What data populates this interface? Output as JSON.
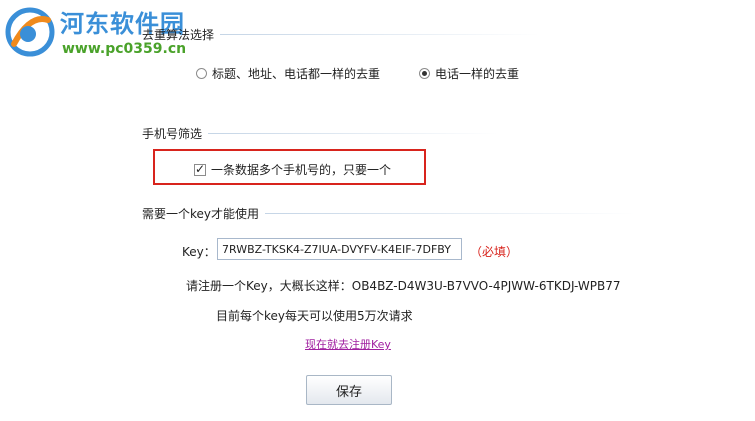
{
  "watermark": {
    "title": "河东软件园",
    "url": "www.pc0359.cn"
  },
  "dedupe": {
    "header": "去重算法选择",
    "options": [
      {
        "label": "标题、地址、电话都一样的去重",
        "selected": false
      },
      {
        "label": "电话一样的去重",
        "selected": true
      }
    ]
  },
  "phone_filter": {
    "header": "手机号筛选",
    "checkbox_label": "一条数据多个手机号的，只要一个",
    "checked": true
  },
  "key_section": {
    "header": "需要一个key才能使用",
    "key_label": "Key：",
    "key_value": "7RWBZ-TKSK4-Z7IUA-DVYFV-K4EIF-7DFBY",
    "required_note": "（必填）",
    "register_hint": "请注册一个Key，大概长这样：OB4BZ-D4W3U-B7VVO-4PJWW-6TKDJ-WPB77",
    "daily_limit": "目前每个key每天可以使用5万次请求",
    "register_link": "现在就去注册Key"
  },
  "actions": {
    "save_label": "保存"
  },
  "colors": {
    "accent_red": "#d8241d",
    "link_purple": "#a020a0",
    "watermark_blue": "#3a8fd8",
    "watermark_green": "#4aa22a"
  }
}
